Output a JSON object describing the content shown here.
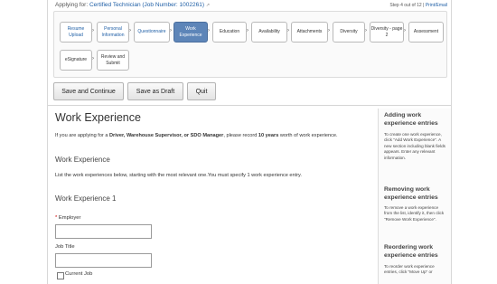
{
  "header": {
    "applying_label": "Applying for:",
    "job_link": "Certified Technician (Job Number: 1002261)",
    "step_indicator": "Step 4 out of 12",
    "print_link": "Print/Email"
  },
  "steps": [
    {
      "label": "Resume Upload",
      "state": "link"
    },
    {
      "label": "Personal Information",
      "state": "link"
    },
    {
      "label": "Questionnaire",
      "state": "link"
    },
    {
      "label": "Work Experience",
      "state": "active"
    },
    {
      "label": "Education",
      "state": "normal"
    },
    {
      "label": "Availability",
      "state": "normal"
    },
    {
      "label": "Attachments",
      "state": "normal"
    },
    {
      "label": "Diversity",
      "state": "normal"
    },
    {
      "label": "Diversity - page 2",
      "state": "normal"
    },
    {
      "label": "Assessment",
      "state": "normal"
    },
    {
      "label": "eSignature",
      "state": "normal"
    },
    {
      "label": "Review and Submit",
      "state": "normal"
    }
  ],
  "buttons": {
    "save_continue": "Save and Continue",
    "save_draft": "Save as Draft",
    "quit": "Quit"
  },
  "main": {
    "title": "Work Experience",
    "intro_pre": "If you are applying for a ",
    "intro_bold1": "Driver, Warehouse Supervisor, or SDO Manager",
    "intro_mid": ", please record ",
    "intro_bold2": "10 years",
    "intro_post": " worth of work experience.",
    "section_title": "Work Experience",
    "section_subtitle": "List the work experiences below, starting with the most relevant one.You must specify 1 work experience entry.",
    "entry_title": "Work Experience 1",
    "required_mark": "*",
    "employer_label": "Employer",
    "job_title_label": "Job Title",
    "employer_value": "",
    "job_title_value": "",
    "current_job_label": "Current Job"
  },
  "sidebar": {
    "adding_title": "Adding work experience entries",
    "adding_text": "To create one work experience, click \"Add Work Experience\". A new section including blank fields appears. Enter any relevant information.",
    "removing_title": "Removing work experience entries",
    "removing_text": "To remove a work experience from the list, identify it, then click \"Remove Work Experience\".",
    "reordering_title": "Reordering work experience entries",
    "reordering_text": "To reorder work experience entries, click \"Move Up\" or"
  }
}
